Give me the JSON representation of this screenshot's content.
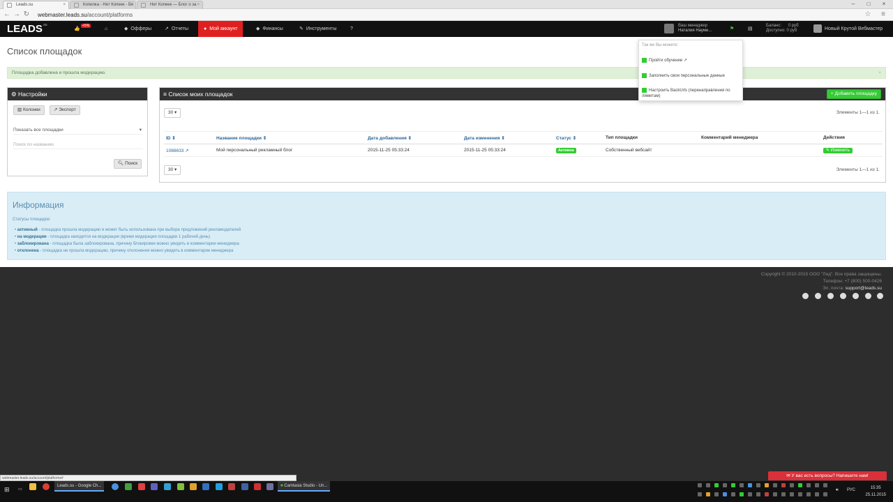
{
  "browser": {
    "tabs": [
      {
        "label": "Leads.su"
      },
      {
        "label": "Копилка - Нет Копеек - Бл"
      },
      {
        "label": "Нет Копеек — Блог о за"
      }
    ],
    "url_domain": "webmaster.leads.su",
    "url_path": "/account/platforms"
  },
  "nav": {
    "logo": "LEADS",
    "logo_sup": ".su",
    "promo_badge": "+5%",
    "items": [
      {
        "label": "Офферы",
        "icon": "tag-icon"
      },
      {
        "label": "Отчеты",
        "icon": "chart-icon"
      },
      {
        "label": "Мой аккаунт",
        "icon": "user-icon"
      },
      {
        "label": "Финансы",
        "icon": "diamond-icon"
      },
      {
        "label": "Инструменты",
        "icon": "wrench-icon"
      }
    ],
    "manager_label": "Ваш менеджер",
    "manager_name": "Наталия Науме...",
    "balance_label": "Баланс:",
    "balance_value": "0 руб",
    "available_label": "Доступно:",
    "available_value": "0 руб",
    "user_name": "Новый Крутой Вебмастер"
  },
  "page": {
    "title": "Список площадок",
    "alert": "Площадка добавлена и прошла модерацию."
  },
  "settings": {
    "title": "Настройки",
    "columns_button": "Колонки",
    "export_button": "Экспорт",
    "filter_select": "Показать все площадки",
    "search_placeholder": "Поиск по названию",
    "search_button": "Поиск"
  },
  "platforms": {
    "title": "Список моих площадок",
    "add_button": "Добавить площадку",
    "page_size": "30",
    "count_text": "Элементы 1—1 из 1.",
    "columns": [
      "ID",
      "Название площадки",
      "Дата добавления",
      "Дата изменения",
      "Статус",
      "Тип площадки",
      "Комментарий менеджера",
      "Действия"
    ],
    "rows": [
      {
        "id": "1088633",
        "name": "Мой персональный рекламный блог",
        "added": "2015-11-25 05:33:24",
        "changed": "2015-11-25 05:33:24",
        "status": "Активна",
        "type": "Собственный вебсайт",
        "comment": "",
        "action": "Изменить"
      }
    ]
  },
  "info": {
    "title": "Информация",
    "subtitle": "Статусы площадок:",
    "items": [
      {
        "term": "активный",
        "desc": " - площадка прошла модерацию и может быть использована при выборе предложений рекламодателей"
      },
      {
        "term": "на модерации",
        "desc": " - площадка находится на модерации (время модерации площадки 1 рабочий день)"
      },
      {
        "term": "заблокирована",
        "desc": " - площадка была заблокирована, причину блокировки можно увидеть в комментарии менеджера"
      },
      {
        "term": "отклонена",
        "desc": " - площадка не прошла модерацию, причину отклонения можно увидеть в комментарии менеджера"
      }
    ]
  },
  "dropdown": {
    "header": "Так же Вы можете:",
    "items": [
      "Пройти обучение",
      "Заполнить свои персональные данные",
      "Настроить BackUrls (перенаправления по лимитам)"
    ]
  },
  "footer": {
    "copyright": "Copyright © 2010-2015 ООО \"Лид\". Все права защищены.",
    "phone": "Телефон: +7 (800) 500-0426",
    "email_label": "Эл. почта:",
    "email": "support@leads.su"
  },
  "chat_button": "У вас есть вопросы? Напишите нам!",
  "status_url": "webmaster.leads.su/account/platforms#",
  "taskbar": {
    "chrome_label": "Leads.su - Google Ch...",
    "camtasia_label": "Camtasia Studio - Un...",
    "lang": "РУС",
    "time": "15:35",
    "date": "25.11.2015"
  }
}
